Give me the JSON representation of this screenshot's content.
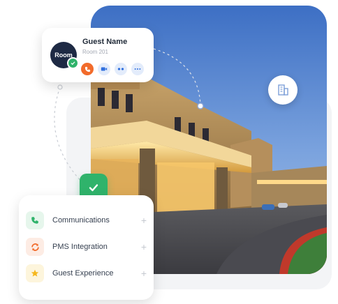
{
  "guest_card": {
    "avatar_label": "Room",
    "name": "Guest Name",
    "room": "Room 201",
    "actions": [
      {
        "icon": "phone-icon",
        "color": "#f26b2b",
        "icon_color": "#ffffff"
      },
      {
        "icon": "video-icon",
        "color": "#e3ecfb",
        "icon_color": "#2f6fde"
      },
      {
        "icon": "message-icon",
        "color": "#e3ecfb",
        "icon_color": "#2f6fde"
      },
      {
        "icon": "more-icon",
        "color": "#e3ecfb",
        "icon_color": "#2f6fde"
      }
    ]
  },
  "status": {
    "icon": "check-icon",
    "color": "#2fb36b"
  },
  "features": [
    {
      "label": "Communications",
      "icon": "phone-icon",
      "icon_bg": "#e6f6ec",
      "icon_color": "#2fb36b",
      "action": "+"
    },
    {
      "label": "PMS Integration",
      "icon": "sync-icon",
      "icon_bg": "#fdece4",
      "icon_color": "#f26b2b",
      "action": "+"
    },
    {
      "label": "Guest Experience",
      "icon": "star-icon",
      "icon_bg": "#fdf5dc",
      "icon_color": "#f5b71b",
      "action": "+"
    }
  ],
  "colors": {
    "brand_green": "#2fb36b",
    "accent_orange": "#f26b2b",
    "sky_blue": "#4f86d6"
  }
}
